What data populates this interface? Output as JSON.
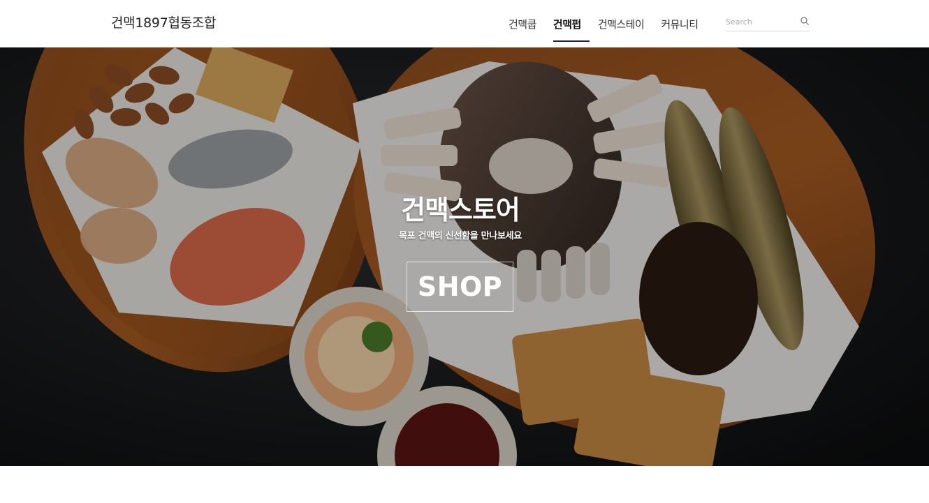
{
  "header": {
    "brand": "건맥1897협동조합",
    "nav": [
      {
        "label": "건맥쿱",
        "active": false
      },
      {
        "label": "건맥펍",
        "active": true
      },
      {
        "label": "건맥스테이",
        "active": false
      },
      {
        "label": "커뮤니티",
        "active": false
      }
    ],
    "search": {
      "placeholder": "Search",
      "icon": "search-icon"
    }
  },
  "hero": {
    "title": "건맥스토어",
    "subtitle": "목포 건맥의 신선함을 만나보세요",
    "button_label": "SHOP",
    "image": "dried-seafood-platter-image"
  },
  "colors": {
    "header_bg": "#ffffff",
    "text": "#222222",
    "hero_text": "#ffffff",
    "active_underline": "#222222"
  }
}
